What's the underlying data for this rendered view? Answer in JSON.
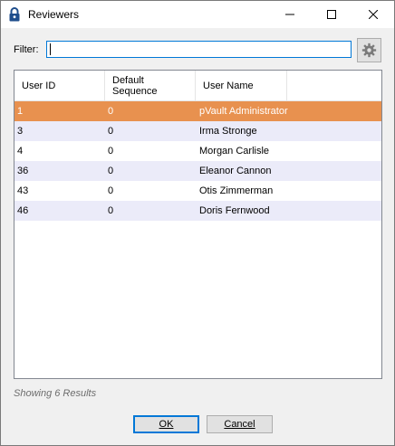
{
  "window": {
    "title": "Reviewers",
    "icon": "lock-icon"
  },
  "filter": {
    "label": "Filter:",
    "value": "",
    "settings_icon": "gear-icon"
  },
  "grid": {
    "columns": [
      "User ID",
      "Default Sequence",
      "User Name"
    ],
    "rows": [
      {
        "user_id": "1",
        "sequence": "0",
        "user_name": "pVault Administrator",
        "selected": true
      },
      {
        "user_id": "3",
        "sequence": "0",
        "user_name": "Irma Stronge"
      },
      {
        "user_id": "4",
        "sequence": "0",
        "user_name": "Morgan Carlisle"
      },
      {
        "user_id": "36",
        "sequence": "0",
        "user_name": "Eleanor Cannon"
      },
      {
        "user_id": "43",
        "sequence": "0",
        "user_name": "Otis Zimmerman"
      },
      {
        "user_id": "46",
        "sequence": "0",
        "user_name": "Doris Fernwood"
      }
    ]
  },
  "status": "Showing 6 Results",
  "buttons": {
    "ok": "OK",
    "cancel": "Cancel"
  },
  "colors": {
    "selected_row": "#e8914f",
    "alt_row": "#ebebf9",
    "focus": "#0078d7"
  }
}
